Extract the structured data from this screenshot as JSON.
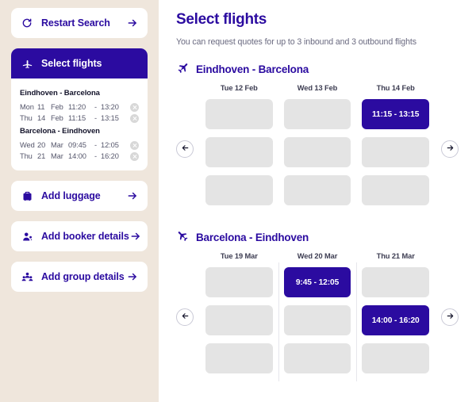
{
  "sidebar": {
    "restart": {
      "label": "Restart Search",
      "icon": "restart-icon",
      "arrow": "arrow-right-icon"
    },
    "select_flights_panel": {
      "header_label": "Select flights",
      "icon": "plane-icon",
      "groups": [
        {
          "title": "Eindhoven - Barcelona",
          "flights": [
            {
              "dow": "Mon",
              "day": "11",
              "month": "Feb",
              "departure": "11:20",
              "dash": "-",
              "arrival": "13:20",
              "remove": "remove-icon"
            },
            {
              "dow": "Thu",
              "day": "14",
              "month": "Feb",
              "departure": "11:15",
              "dash": "-",
              "arrival": "13:15",
              "remove": "remove-icon"
            }
          ]
        },
        {
          "title": "Barcelona - Eindhoven",
          "flights": [
            {
              "dow": "Wed",
              "day": "20",
              "month": "Mar",
              "departure": "09:45",
              "dash": "-",
              "arrival": "12:05",
              "remove": "remove-icon"
            },
            {
              "dow": "Thu",
              "day": "21",
              "month": "Mar",
              "departure": "14:00",
              "dash": "-",
              "arrival": "16:20",
              "remove": "remove-icon"
            }
          ]
        }
      ]
    },
    "items": [
      {
        "label": "Add luggage",
        "icon": "luggage-icon",
        "arrow": "arrow-right-icon"
      },
      {
        "label": "Add booker details",
        "icon": "person-icon",
        "arrow": "arrow-right-icon"
      },
      {
        "label": "Add group details",
        "icon": "group-icon",
        "arrow": "arrow-right-icon"
      }
    ]
  },
  "main": {
    "title": "Select flights",
    "subtitle": "You can request quotes for up to 3 inbound and 3 outbound flights",
    "prev_label": "←",
    "next_label": "→",
    "legs": [
      {
        "title": "Eindhoven - Barcelona",
        "icon": "plane-depart-icon",
        "columns": [
          {
            "header": "Tue 12 Feb",
            "slots": [
              {
                "label": "",
                "selected": false
              },
              {
                "label": "",
                "selected": false
              },
              {
                "label": "",
                "selected": false
              }
            ]
          },
          {
            "header": "Wed 13 Feb",
            "slots": [
              {
                "label": "",
                "selected": false
              },
              {
                "label": "",
                "selected": false
              },
              {
                "label": "",
                "selected": false
              }
            ]
          },
          {
            "header": "Thu 14 Feb",
            "slots": [
              {
                "label": "11:15 - 13:15",
                "selected": true
              },
              {
                "label": "",
                "selected": false
              },
              {
                "label": "",
                "selected": false
              }
            ]
          }
        ]
      },
      {
        "title": "Barcelona - Eindhoven",
        "icon": "plane-arrive-icon",
        "columns": [
          {
            "header": "Tue 19 Mar",
            "slots": [
              {
                "label": "",
                "selected": false
              },
              {
                "label": "",
                "selected": false
              },
              {
                "label": "",
                "selected": false
              }
            ]
          },
          {
            "header": "Wed 20 Mar",
            "slots": [
              {
                "label": "9:45 - 12:05",
                "selected": true
              },
              {
                "label": "",
                "selected": false
              },
              {
                "label": "",
                "selected": false
              }
            ]
          },
          {
            "header": "Thu 21 Mar",
            "slots": [
              {
                "label": "",
                "selected": false
              },
              {
                "label": "14:00 - 16:20",
                "selected": true
              },
              {
                "label": "",
                "selected": false
              }
            ]
          }
        ]
      }
    ]
  },
  "colors": {
    "brand": "#2b0ba0",
    "sidebar_bg": "#efe6dc",
    "slot_empty": "#e4e4e4",
    "muted_text": "#6a6a80"
  }
}
